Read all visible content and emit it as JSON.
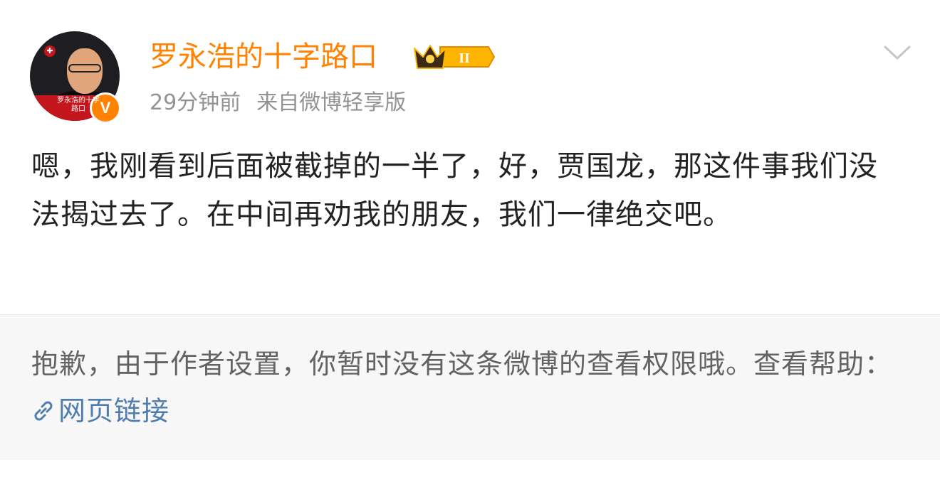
{
  "post": {
    "avatar_caption": "罗永浩的十字路口",
    "username": "罗永浩的十字路口",
    "vip_level": "II",
    "time": "29分钟前",
    "source": "来自微博轻享版",
    "content": "嗯，我刚看到后面被截掉的一半了，好，贾国龙，那这件事我们没法揭过去了。在中间再劝我的朋友，我们一律绝交吧。"
  },
  "repost": {
    "notice": "抱歉，由于作者设置，你暂时没有这条微博的查看权限哦。查看帮助：",
    "link_label": "网页链接"
  },
  "colors": {
    "brand_orange": "#ff8200",
    "link_blue": "#507daf",
    "meta_gray": "#939393"
  },
  "icons": {
    "avatar": "avatar-photo",
    "verified": "verified-v-icon",
    "vip": "vip-crown-badge",
    "more": "chevron-down-icon",
    "link": "link-icon"
  }
}
